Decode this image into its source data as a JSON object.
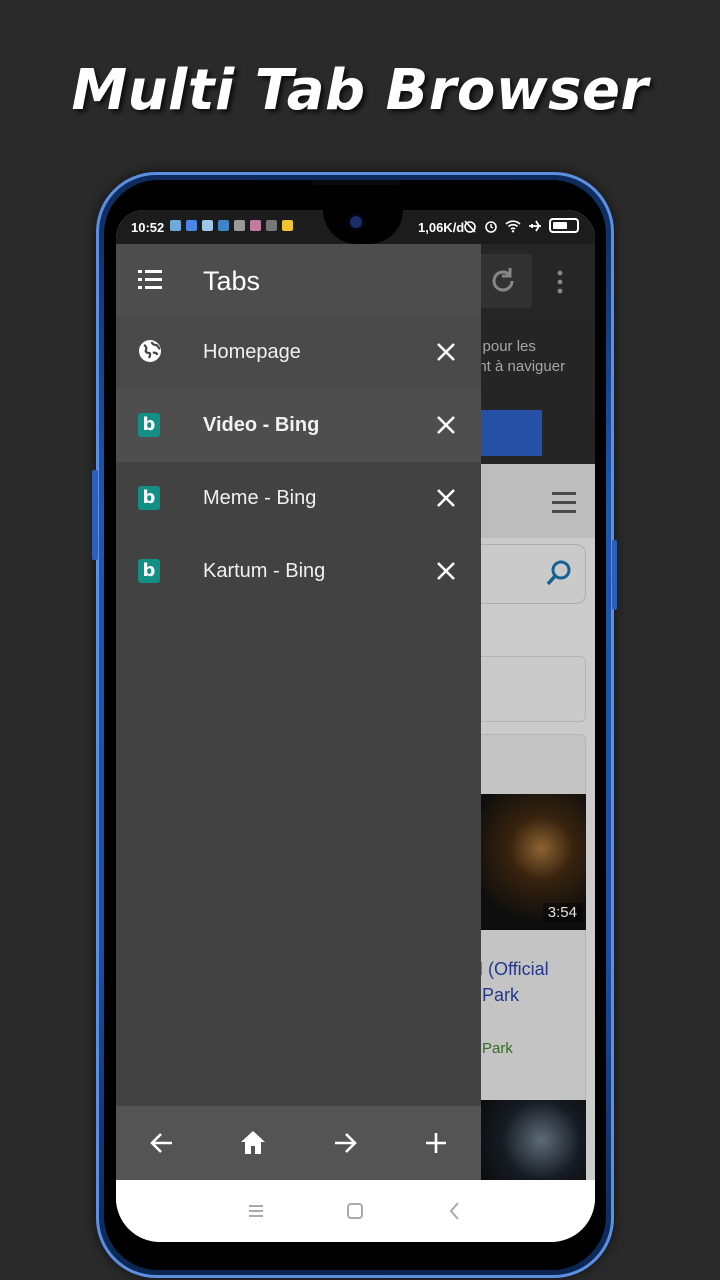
{
  "promo": {
    "headline": "Multi Tab Browser"
  },
  "status_bar": {
    "time": "10:52",
    "net_speed": "1,06K/d",
    "icons": [
      "alarm-off-icon",
      "alarm-icon",
      "wifi-icon",
      "airplane-icon",
      "battery-icon"
    ]
  },
  "drawer": {
    "title": "Tabs",
    "tabs": [
      {
        "label": "Homepage",
        "icon": "globe-icon",
        "active": false
      },
      {
        "label": "Video - Bing",
        "icon": "bing-icon",
        "active": true
      },
      {
        "label": "Meme - Bing",
        "icon": "bing-icon",
        "active": false
      },
      {
        "label": "Kartum - Bing",
        "icon": "bing-icon",
        "active": false
      }
    ],
    "bing_letter": "b",
    "footer_buttons": [
      "back-arrow-icon",
      "home-icon",
      "forward-arrow-icon",
      "add-tab-icon"
    ]
  },
  "background_page": {
    "banner_line1": "e pour les",
    "banner_line2": "ant à naviguer",
    "video_duration": "3:54",
    "video_title_line1": "N (Official",
    "video_title_line2": "Park",
    "video_source": "Park"
  },
  "system_nav": [
    "recents-icon",
    "home-square-icon",
    "back-chevron-icon"
  ],
  "colors": {
    "background": "#2b2a2a",
    "phone_frame": "#1f56b0",
    "drawer": "#424242",
    "bing": "#138f86",
    "link": "#2a3fa0"
  }
}
